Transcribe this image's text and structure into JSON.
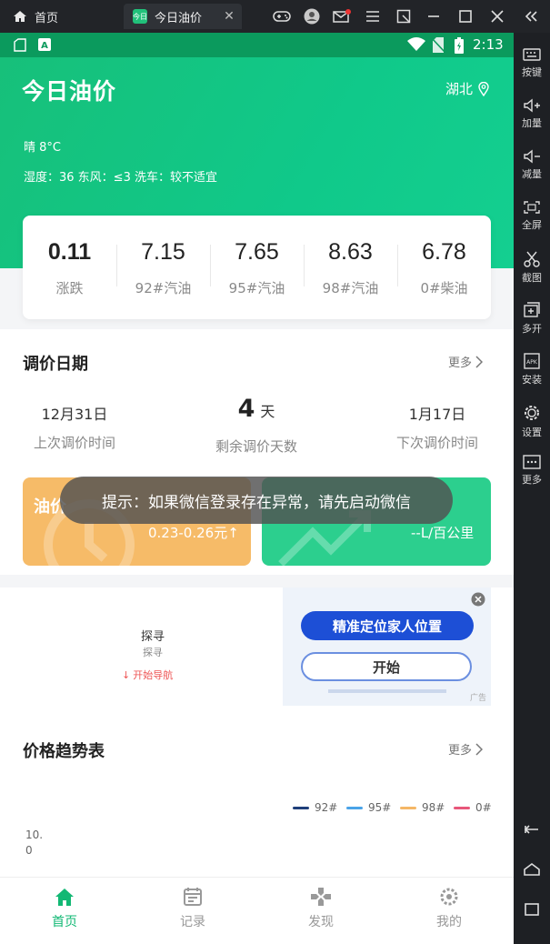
{
  "titlebar": {
    "home_label": "首页",
    "tab_label": "今日油价",
    "tab_icon_text": "今日"
  },
  "sidebar": {
    "items": [
      {
        "label": "按键"
      },
      {
        "label": "加量"
      },
      {
        "label": "减量"
      },
      {
        "label": "全屏"
      },
      {
        "label": "截图"
      },
      {
        "label": "多开"
      },
      {
        "label": "安装"
      },
      {
        "label": "设置"
      },
      {
        "label": "更多"
      }
    ]
  },
  "statusbar": {
    "time": "2:13"
  },
  "header": {
    "title": "今日油价",
    "region": "湖北",
    "weather_main": "晴 8°C",
    "weather_detail": "湿度：36  东风：≤3  洗车：较不适宜"
  },
  "prices": [
    {
      "value": "0.11",
      "label": "涨跌"
    },
    {
      "value": "7.15",
      "label": "92#汽油"
    },
    {
      "value": "7.65",
      "label": "95#汽油"
    },
    {
      "value": "8.63",
      "label": "98#汽油"
    },
    {
      "value": "6.78",
      "label": "0#柴油"
    }
  ],
  "adjust": {
    "title": "调价日期",
    "more": "更多",
    "last_date": "12月31日",
    "last_label": "上次调价时间",
    "days_value": "4",
    "days_unit": "天",
    "days_label": "剩余调价天数",
    "next_date": "1月17日",
    "next_label": "下次调价时间",
    "orange_title": "油价",
    "orange_value": "0.23-0.26元↑",
    "green_value": "--L/百公里"
  },
  "toast": "提示：如果微信登录存在异常，请先启动微信",
  "ad": {
    "title": "探寻",
    "subtitle": "探寻",
    "nav_link": "开始导航",
    "banner_primary": "精准定位家人位置",
    "banner_secondary": "开始",
    "ad_tag": "广告"
  },
  "trend": {
    "title": "价格趋势表",
    "more": "更多",
    "legend": [
      "92#",
      "95#",
      "98#",
      "0#"
    ],
    "y_label_line1": "10.",
    "y_label_line2": "0"
  },
  "bottomnav": {
    "items": [
      {
        "label": "首页"
      },
      {
        "label": "记录"
      },
      {
        "label": "发现"
      },
      {
        "label": "我的"
      }
    ]
  },
  "colors": {
    "brand_green": "#12c281",
    "accent_orange": "#f6bb68",
    "legend_92": "#1f3f7a",
    "legend_95": "#4aa3e8",
    "legend_98": "#f5b766",
    "legend_0": "#e8577a"
  }
}
